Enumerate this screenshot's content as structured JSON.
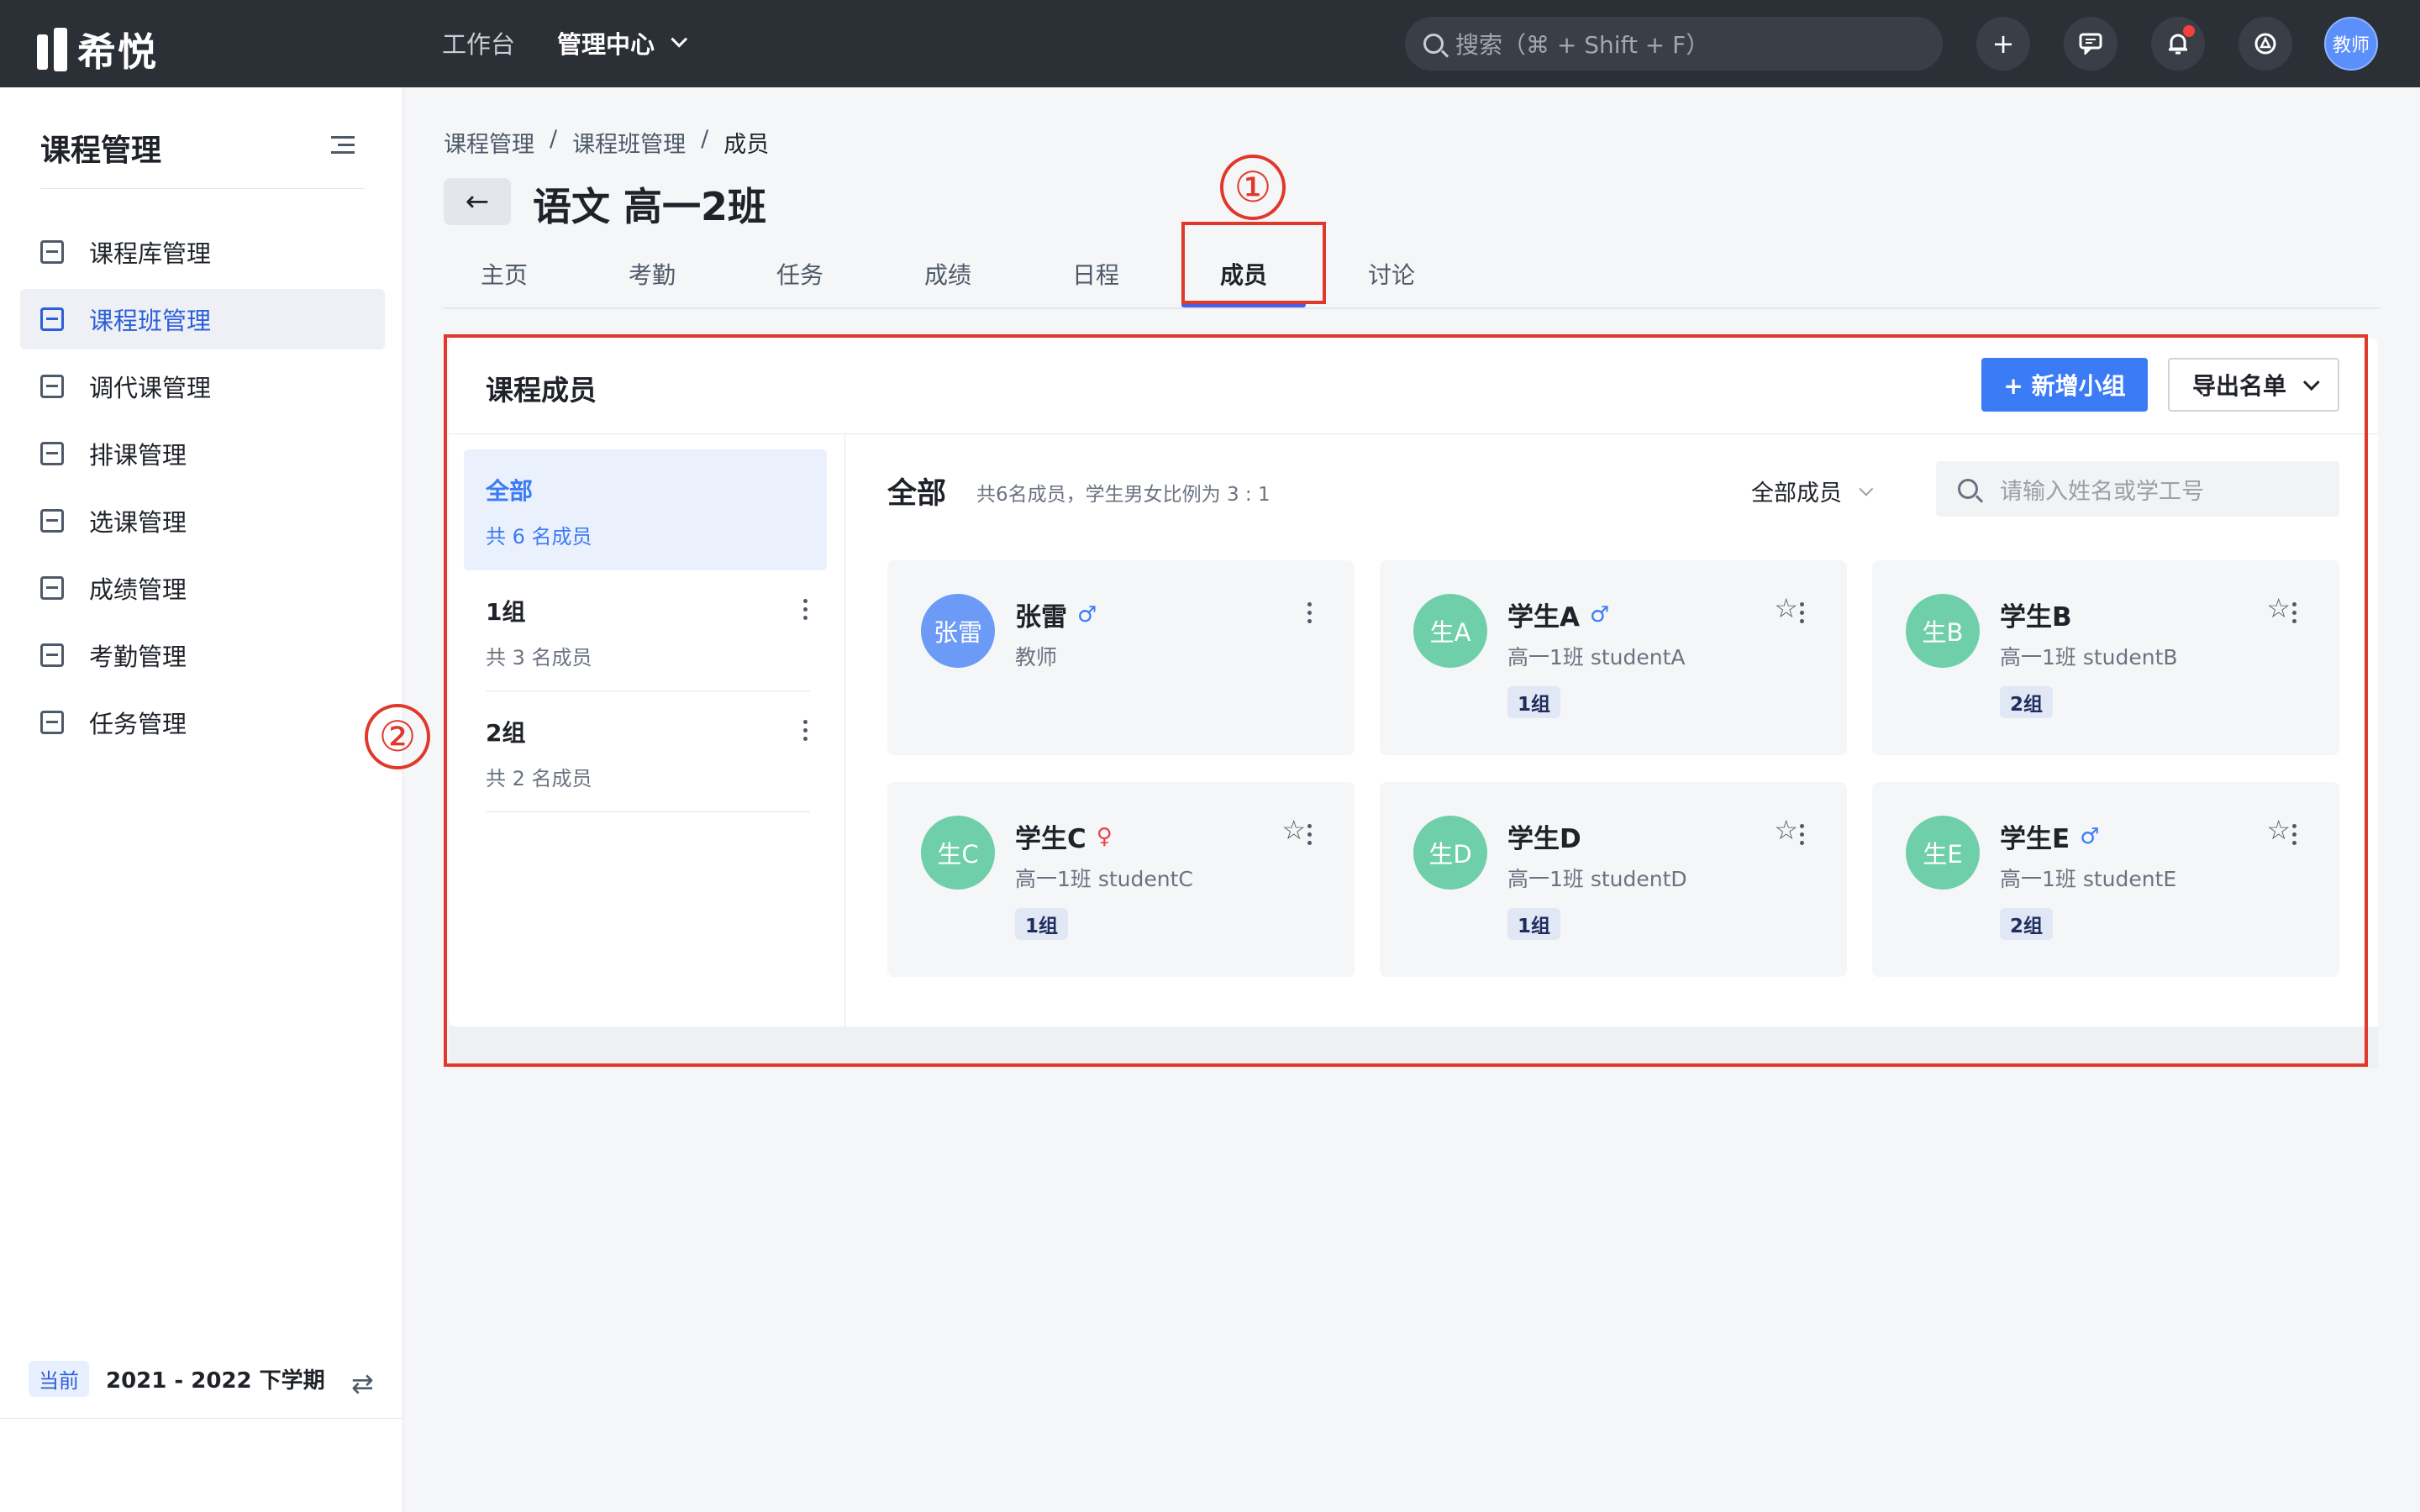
{
  "topbar": {
    "logo_text": "希悦",
    "nav": [
      "工作台",
      "管理中心"
    ],
    "search_placeholder": "搜索（⌘ + Shift + F）",
    "avatar_label": "教师"
  },
  "sidebar": {
    "title": "课程管理",
    "items": [
      {
        "label": "课程库管理",
        "icon": "list-icon"
      },
      {
        "label": "课程班管理",
        "icon": "class-icon"
      },
      {
        "label": "调代课管理",
        "icon": "swap-course-icon"
      },
      {
        "label": "排课管理",
        "icon": "schedule-icon"
      },
      {
        "label": "选课管理",
        "icon": "checkbox-icon"
      },
      {
        "label": "成绩管理",
        "icon": "grade-icon"
      },
      {
        "label": "考勤管理",
        "icon": "calendar-check-icon"
      },
      {
        "label": "任务管理",
        "icon": "tasks-icon"
      }
    ],
    "active_index": 1,
    "term_tag": "当前",
    "term_value": "2021 - 2022 下学期"
  },
  "breadcrumb": [
    "课程管理",
    "/",
    "课程班管理",
    "/",
    "成员"
  ],
  "page_title": "语文 高一2班",
  "tabs": [
    "主页",
    "考勤",
    "任务",
    "成绩",
    "日程",
    "成员",
    "讨论"
  ],
  "active_tab": "成员",
  "annotations": {
    "one": "①",
    "two": "②"
  },
  "card": {
    "title": "课程成员",
    "add_group_button": "+ 新增小组",
    "export_button": "导出名单"
  },
  "groups": [
    {
      "name": "全部",
      "count": "共 6 名成员"
    },
    {
      "name": "1组",
      "count": "共 3 名成员"
    },
    {
      "name": "2组",
      "count": "共 2 名成员"
    }
  ],
  "members_header": {
    "title": "全部",
    "subtitle": "共6名成员，学生男女比例为 3 : 1",
    "filter": "全部成员",
    "search_placeholder": "请输入姓名或学工号"
  },
  "members": [
    {
      "avatar": "张雷",
      "name": "张雷",
      "gender": "♂",
      "info": "教师",
      "tag": "",
      "color": "#6c9bf7"
    },
    {
      "avatar": "生A",
      "name": "学生A",
      "gender": "♂",
      "info": "高一1班 studentA",
      "tag": "1组",
      "color": "#6fcfaa"
    },
    {
      "avatar": "生B",
      "name": "学生B",
      "gender": "",
      "info": "高一1班 studentB",
      "tag": "2组",
      "color": "#6fcfaa"
    },
    {
      "avatar": "生C",
      "name": "学生C",
      "gender": "♀",
      "info": "高一1班 studentC",
      "tag": "1组",
      "color": "#6fcfaa"
    },
    {
      "avatar": "生D",
      "name": "学生D",
      "gender": "",
      "info": "高一1班 studentD",
      "tag": "1组",
      "color": "#6fcfaa"
    },
    {
      "avatar": "生E",
      "name": "学生E",
      "gender": "♂",
      "info": "高一1班 studentE",
      "tag": "2组",
      "color": "#6fcfaa"
    }
  ],
  "colors": {
    "male": "#3b7bf6",
    "female": "#e5484d",
    "accent": "#3b7bf6",
    "annotation": "#e0392b"
  }
}
